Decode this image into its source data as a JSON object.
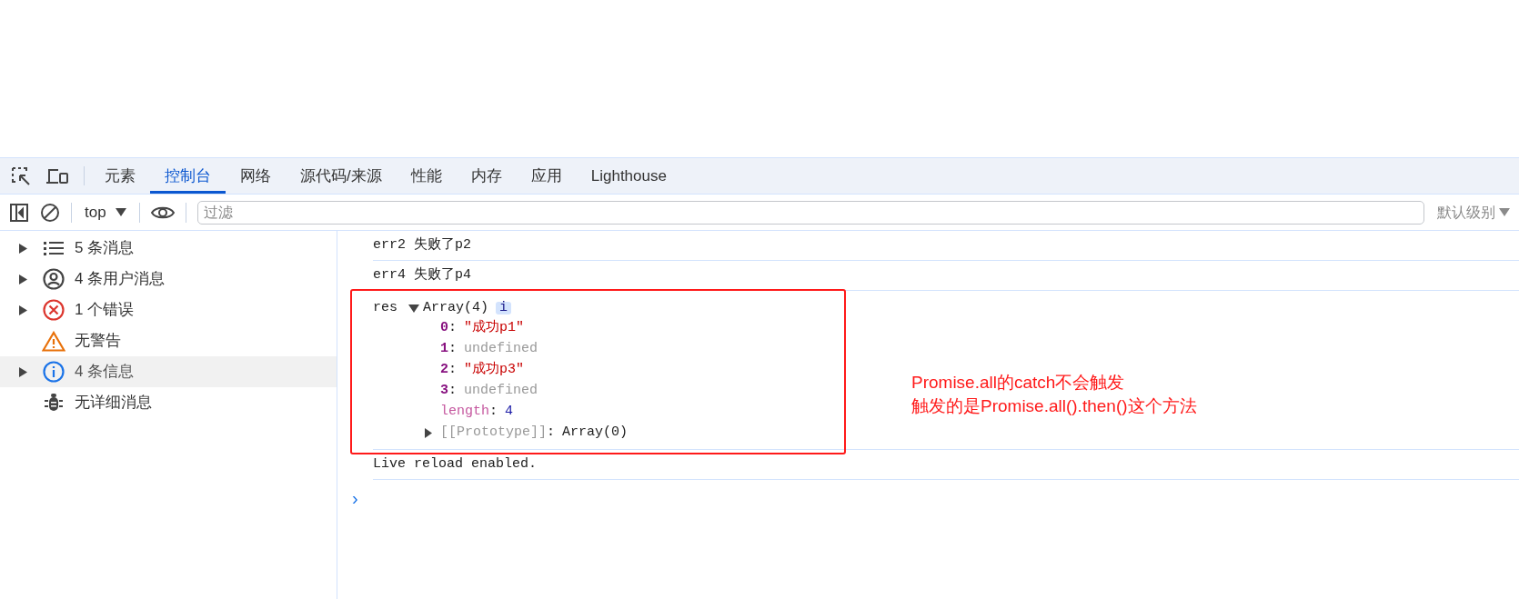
{
  "tabs": [
    {
      "label": "元素",
      "selected": false
    },
    {
      "label": "控制台",
      "selected": true
    },
    {
      "label": "网络",
      "selected": false
    },
    {
      "label": "源代码/来源",
      "selected": false
    },
    {
      "label": "性能",
      "selected": false
    },
    {
      "label": "内存",
      "selected": false
    },
    {
      "label": "应用",
      "selected": false
    },
    {
      "label": "Lighthouse",
      "selected": false
    }
  ],
  "toolbar": {
    "context": "top",
    "filter": {
      "placeholder": "过滤"
    },
    "levels": "默认级别"
  },
  "sidebar": {
    "items": [
      {
        "kind": "all",
        "label": "5 条消息",
        "expandable": true,
        "selected": false
      },
      {
        "kind": "user",
        "label": "4 条用户消息",
        "expandable": true,
        "selected": false
      },
      {
        "kind": "error",
        "label": "1 个错误",
        "expandable": true,
        "selected": false
      },
      {
        "kind": "warning",
        "label": "无警告",
        "expandable": false,
        "selected": false
      },
      {
        "kind": "info",
        "label": "4 条信息",
        "expandable": true,
        "selected": true
      },
      {
        "kind": "verbose",
        "label": "无详细消息",
        "expandable": false,
        "selected": false
      }
    ]
  },
  "console": {
    "messages": [
      {
        "kind": "text",
        "text": "err2 失败了p2"
      },
      {
        "kind": "text",
        "text": "err4 失败了p4"
      },
      {
        "kind": "object",
        "label": "res",
        "expanded": true,
        "summary": "Array(4)",
        "badge": "i",
        "entries": [
          {
            "kind": "string",
            "key": "0",
            "separator": ":",
            "value": "\"成功p1\""
          },
          {
            "kind": "undefined",
            "key": "1",
            "separator": ":",
            "value": "undefined"
          },
          {
            "kind": "string",
            "key": "2",
            "separator": ":",
            "value": "\"成功p3\""
          },
          {
            "kind": "undefined",
            "key": "3",
            "separator": ":",
            "value": "undefined"
          },
          {
            "kind": "number",
            "key": "length",
            "separator": ":",
            "value": "4"
          },
          {
            "kind": "prototype",
            "key": "[[Prototype]]",
            "separator": ":",
            "value": "Array(0)"
          }
        ]
      },
      {
        "kind": "text",
        "text": "Live reload enabled."
      }
    ],
    "prompt": "›"
  },
  "annotation": {
    "lines": [
      "Promise.all的catch不会触发",
      "触发的是Promise.all().then()这个方法"
    ]
  }
}
